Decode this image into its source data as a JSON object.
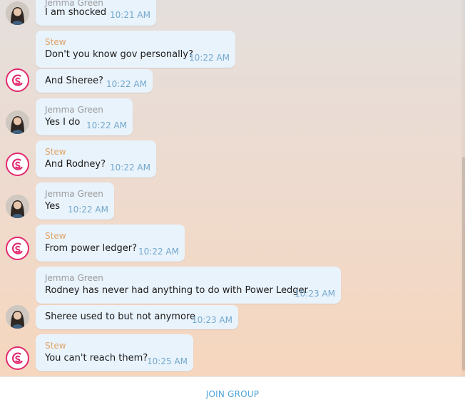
{
  "messages": [
    {
      "sender": "Jemma Green",
      "text": "I am shocked",
      "time": "10:21 AM"
    },
    {
      "sender": "Stew",
      "text": "Don't you know gov personally?",
      "time": "10:22 AM"
    },
    {
      "text": "And Sheree?",
      "time": "10:22 AM"
    },
    {
      "sender": "Jemma Green",
      "text": "Yes I do",
      "time": "10:22 AM"
    },
    {
      "sender": "Stew",
      "text": "And Rodney?",
      "time": "10:22 AM"
    },
    {
      "sender": "Jemma Green",
      "text": "Yes",
      "time": "10:22 AM"
    },
    {
      "sender": "Stew",
      "text": "From power ledger?",
      "time": "10:22 AM"
    },
    {
      "sender": "Jemma Green",
      "text": "Rodney has never had anything to do with Power Ledger",
      "time": "10:23 AM"
    },
    {
      "text": "Sheree used to but not anymore",
      "time": "10:23 AM"
    },
    {
      "sender": "Stew",
      "text": "You can't reach them?",
      "time": "10:25 AM"
    }
  ],
  "footer": {
    "join_label": "JOIN GROUP"
  },
  "colors": {
    "bubble": "#e9f3fc",
    "sender_jemma": "#9a9a9a",
    "sender_stew": "#e0a367",
    "time": "#74a8cc",
    "stew_logo": "#e2296f",
    "join": "#4fa3d8"
  }
}
